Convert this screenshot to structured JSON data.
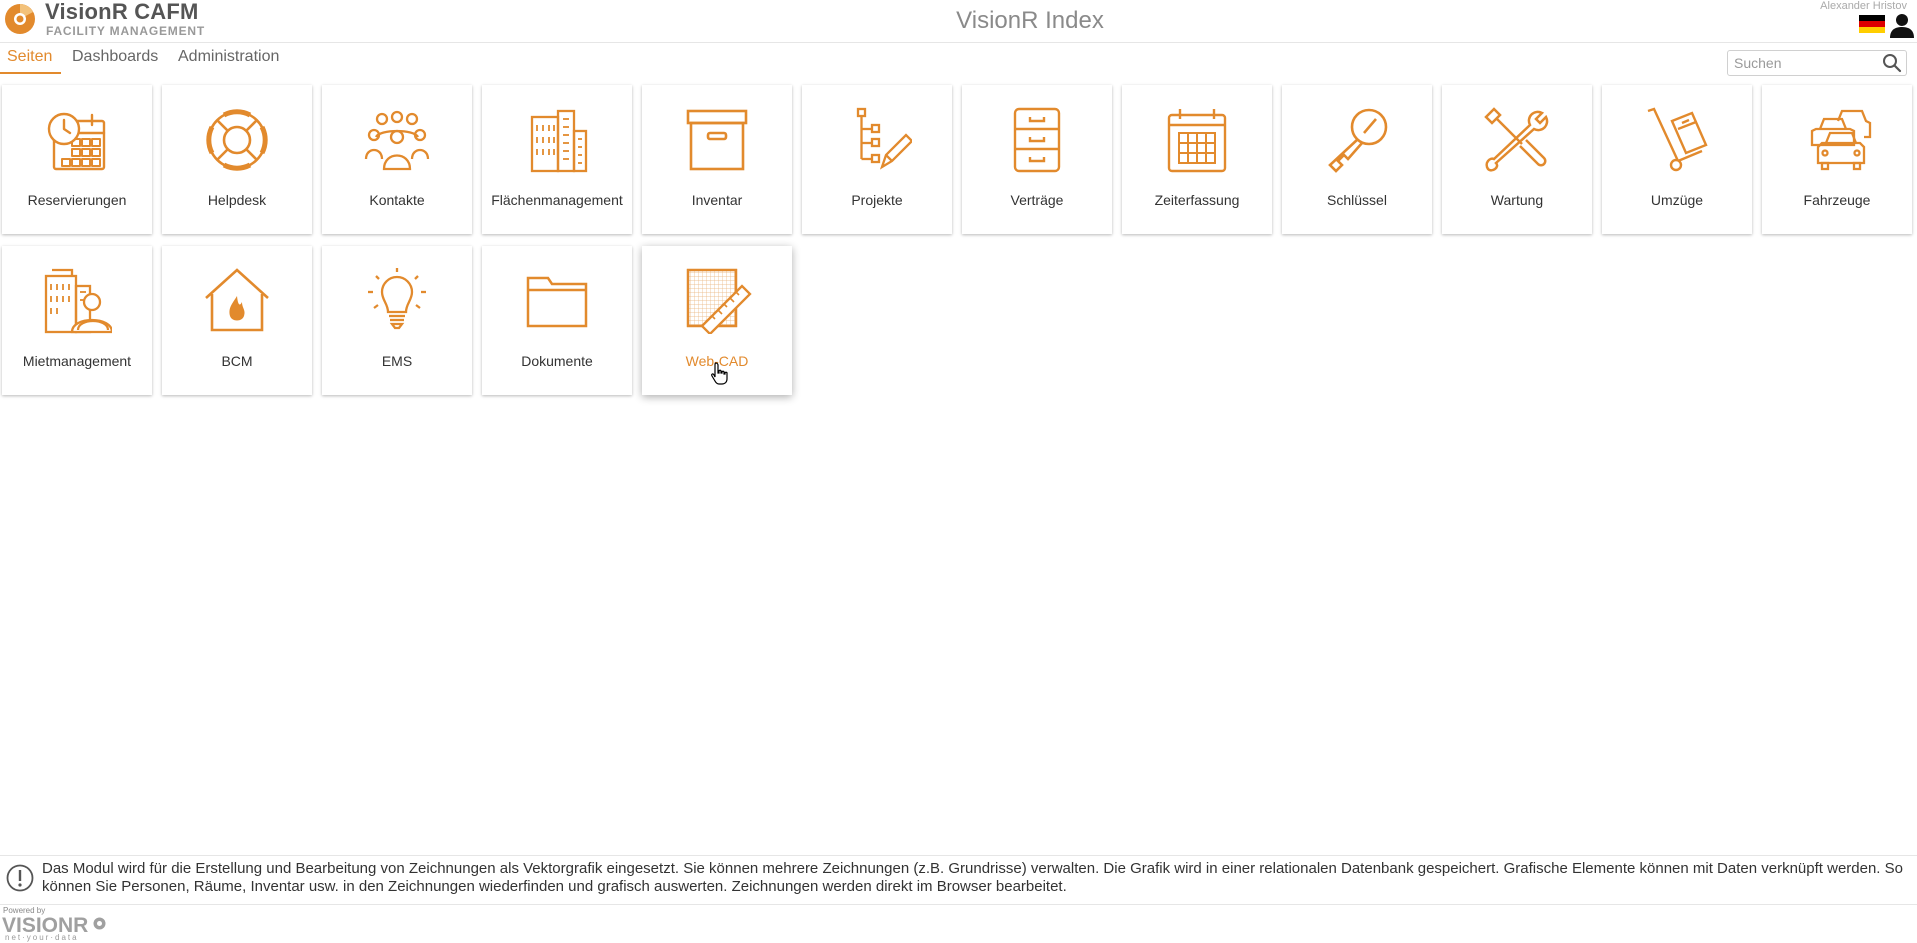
{
  "header": {
    "app_name": "VisionR CAFM",
    "app_subtitle": "FACILITY MANAGEMENT",
    "page_title": "VisionR Index",
    "user_name": "Alexander Hristov"
  },
  "nav": {
    "tabs": [
      {
        "label": "Seiten",
        "active": true
      },
      {
        "label": "Dashboards",
        "active": false
      },
      {
        "label": "Administration",
        "active": false
      }
    ]
  },
  "search": {
    "placeholder": "Suchen"
  },
  "tiles": [
    {
      "label": "Reservierungen",
      "icon": "calendar-clock-icon"
    },
    {
      "label": "Helpdesk",
      "icon": "lifebuoy-icon"
    },
    {
      "label": "Kontakte",
      "icon": "people-group-icon"
    },
    {
      "label": "Flächenmanagement",
      "icon": "buildings-icon"
    },
    {
      "label": "Inventar",
      "icon": "archive-box-icon"
    },
    {
      "label": "Projekte",
      "icon": "project-tree-icon"
    },
    {
      "label": "Verträge",
      "icon": "file-cabinet-icon"
    },
    {
      "label": "Zeiterfassung",
      "icon": "calendar-icon"
    },
    {
      "label": "Schlüssel",
      "icon": "key-icon"
    },
    {
      "label": "Wartung",
      "icon": "wrench-screwdriver-icon"
    },
    {
      "label": "Umzüge",
      "icon": "hand-truck-icon"
    },
    {
      "label": "Fahrzeuge",
      "icon": "cars-icon"
    },
    {
      "label": "Mietmanagement",
      "icon": "building-person-icon"
    },
    {
      "label": "BCM",
      "icon": "house-fire-icon"
    },
    {
      "label": "EMS",
      "icon": "lightbulb-icon"
    },
    {
      "label": "Dokumente",
      "icon": "folder-icon"
    },
    {
      "label": "Web-CAD",
      "icon": "drawing-ruler-icon"
    }
  ],
  "info": {
    "text": "Das Modul wird für die Erstellung und Bearbeitung von Zeichnungen als Vektorgrafik eingesetzt. Sie können mehrere Zeichnungen (z.B. Grundrisse) verwalten. Die Grafik wird in einer relationalen Datenbank gespeichert. Grafische Elemente können mit Daten verknüpft werden. So können Sie Personen, Räume, Inventar usw. in den Zeichnungen wiederfinden und grafisch auswerten. Zeichnungen werden direkt im Browser bearbeitet."
  },
  "footer": {
    "powered_by": "Powered by",
    "logo_text": "VISIONR",
    "tagline": "net·your·data"
  },
  "colors": {
    "accent": "#e28a2d",
    "text": "#333333",
    "muted": "#999999"
  }
}
